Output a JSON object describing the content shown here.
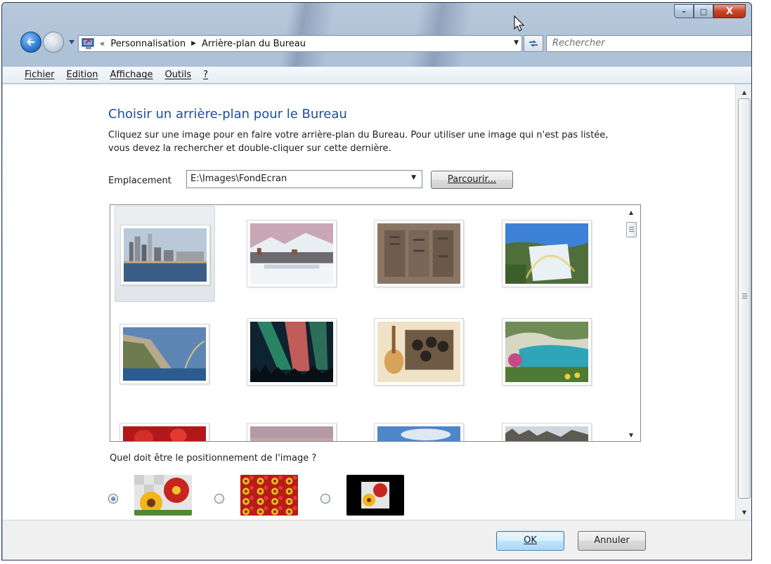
{
  "window": {
    "caption_buttons": {
      "minimize": "–",
      "maximize": "□",
      "close": "X"
    }
  },
  "address_bar": {
    "chevrons": "«",
    "crumbs": [
      "Personnalisation",
      "Arrière-plan du Bureau"
    ],
    "separator_icon": "triangle-right-icon",
    "dropdown_icon": "triangle-down-icon",
    "refresh_icon": "refresh-icon"
  },
  "search": {
    "placeholder": "Rechercher",
    "icon": "search-icon"
  },
  "menu": {
    "items": [
      "Fichier",
      "Edition",
      "Affichage",
      "Outils",
      "?"
    ]
  },
  "page": {
    "title": "Choisir un arrière-plan pour le Bureau",
    "description": "Cliquez sur une image pour en faire votre arrière-plan du Bureau. Pour utiliser une image qui n'est pas listée, vous devez la rechercher et double-cliquer sur cette dernière."
  },
  "location": {
    "label": "Emplacement",
    "value": "E:\\Images\\FondEcran",
    "browse_button": "Parcourir..."
  },
  "gallery": {
    "selected_index": 0,
    "images": [
      "city-waterfront",
      "snowy-mountain-town",
      "stone-carving",
      "waterfall-rainbow",
      "coastal-cliff-rainbow",
      "aurora-borealis",
      "beatles-album-guitar",
      "turquoise-cove",
      "red-flowers",
      "pink-sky",
      "blue-sky-clouds",
      "rock-formations"
    ]
  },
  "positioning": {
    "question": "Quel doit être le positionnement de l'image ?",
    "options": [
      "fill-screen",
      "tile",
      "center"
    ],
    "selected": "fill-screen"
  },
  "footer": {
    "ok": "OK",
    "cancel": "Annuler"
  }
}
